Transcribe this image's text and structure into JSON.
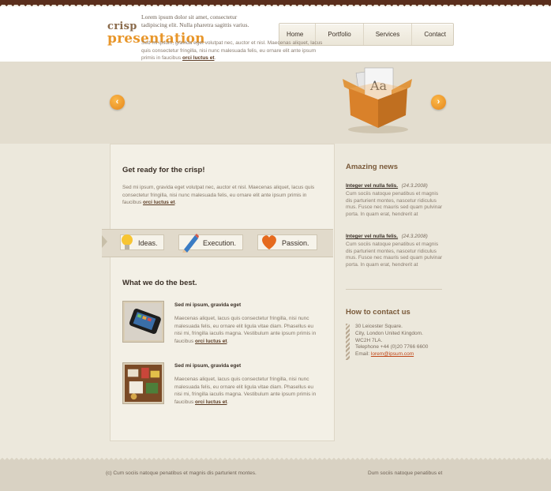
{
  "brand": {
    "top": "crisp",
    "bottom": "presentation"
  },
  "nav": [
    {
      "label": "Home"
    },
    {
      "label": "Portfolio"
    },
    {
      "label": "Services"
    },
    {
      "label": "Contact"
    }
  ],
  "hero": {
    "intro": "Lorem ipsum dolor sit amet, consectetur tadipiscing elit. Nulla pharetra sagittis varius.",
    "body": "Sed mi ipsum, gravida eget volutpat nec, auctor et nisl. Maecenas aliquet, lacus quis consectetur fringilla, nisi nunc malesuada felis, eu ornare elit ante ipsum primis in faucibus",
    "link": "orci luctus et",
    "prev_icon": "chevron-left",
    "next_icon": "chevron-right",
    "box_label": "Aa"
  },
  "ready": {
    "title": "Get ready for the crisp!",
    "body": "Sed mi ipsum, gravida eget volutpat nec, auctor et nisl. Maecenas aliquet, lacus quis consectetur fringilla, nisi nunc malesuada felis, eu ornare elit ante ipsum primis in faucibus",
    "link": "orci luctus et"
  },
  "pills": [
    {
      "label": "Ideas.",
      "icon": "lightbulb-icon"
    },
    {
      "label": "Execution.",
      "icon": "pencil-icon"
    },
    {
      "label": "Passion.",
      "icon": "heart-icon"
    }
  ],
  "what": {
    "title": "What we do the best.",
    "items": [
      {
        "title": "Sed mi ipsum, gravida eget",
        "body": "Maecenas aliquet, lacus quis consectetur fringilla, nisi nunc malesuada felis, eu ornare elit ligula vitae diam. Phasellus eu nisi mi, fringilla iaculis magna. Vestibulum ante ipsum primis in faucibus",
        "link": "orci luctus et",
        "image": "phone-photo"
      },
      {
        "title": "Sed mi ipsum, gravida eget",
        "body": "Maecenas aliquet, lacus quis consectetur fringilla, nisi nunc malesuada felis, eu ornare elit ligula vitae diam. Phasellus eu nisi mi, fringilla iaculis magna. Vestibulum ante ipsum primis in faucibus",
        "link": "orci luctus et",
        "image": "desk-photo"
      }
    ]
  },
  "news": {
    "title": "Amazing news",
    "items": [
      {
        "link": "Integer vel nulla felis.",
        "date": "(24.3.2008)",
        "body": "Cum sociis natoque penatibus et magnis dis parturient montes, nascetur ridiculus mus. Fusce nec mauris sed quam pulvinar porta. In quam erat, hendrerit at"
      },
      {
        "link": "Integer vel nulla felis.",
        "date": "(24.3.2008)",
        "body": "Cum sociis natoque penatibus et magnis dis parturient montes, nascetur ridiculus mus. Fusce nec mauris sed quam pulvinar porta. In quam erat, hendrerit at"
      }
    ]
  },
  "contact": {
    "title": "How to contact us",
    "lines": [
      "30 Leicester Square.",
      "City, London United Kingdom.",
      "WC2H 7LA.",
      "Telephone +44 (0)20 7766 6600"
    ],
    "email_label": "Email:",
    "email": "lorem@ipsum.com"
  },
  "footer": {
    "left": "(c) Cum sociis natoque penatibus et magnis dis parturient montes.",
    "right": "Dum sociis natoque penatibus et"
  }
}
